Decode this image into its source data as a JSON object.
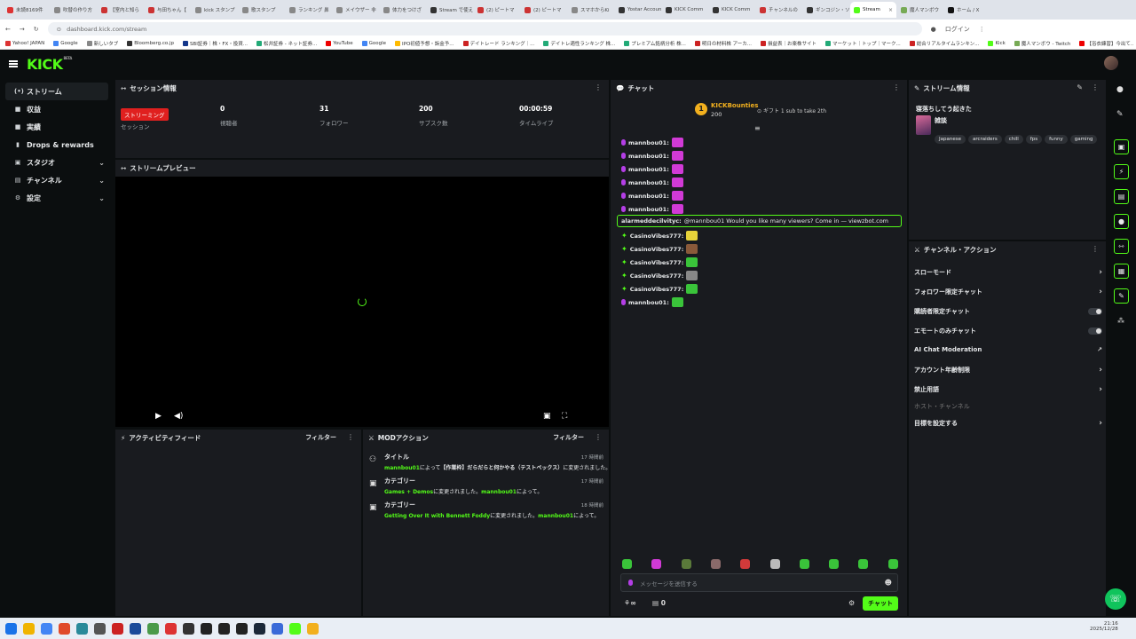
{
  "browser": {
    "tabs": [
      {
        "label": "未読8169件",
        "color": "#d33"
      },
      {
        "label": "吹替の作り方",
        "color": "#888"
      },
      {
        "label": "【室内と知ら",
        "color": "#c33"
      },
      {
        "label": "与田ちゃん【",
        "color": "#c33"
      },
      {
        "label": "kick スタンプ",
        "color": "#888"
      },
      {
        "label": "歌スタンプ",
        "color": "#888"
      },
      {
        "label": "ランキング 鼻",
        "color": "#888"
      },
      {
        "label": "メイウザー 非",
        "color": "#888"
      },
      {
        "label": "体力をつけざ",
        "color": "#888"
      },
      {
        "label": "Stream で使え",
        "color": "#333"
      },
      {
        "label": "(2) ピートマ",
        "color": "#c33"
      },
      {
        "label": "(2) ピートマ",
        "color": "#c33"
      },
      {
        "label": "スマホからKi",
        "color": "#888"
      },
      {
        "label": "Yostar Account",
        "color": "#333"
      },
      {
        "label": "KICK Comm",
        "color": "#333"
      },
      {
        "label": "KICK Comm",
        "color": "#333"
      },
      {
        "label": "チャンネルの",
        "color": "#c33"
      },
      {
        "label": "ギンコジン・ソ",
        "color": "#333"
      },
      {
        "label": "Stream",
        "color": "#53fc18",
        "active": true
      },
      {
        "label": "魔人マンボウ",
        "color": "#7a5"
      },
      {
        "label": "ホーム / X",
        "color": "#111"
      }
    ],
    "url": "dashboard.kick.com/stream",
    "login_label": "ログイン",
    "bookmarks": [
      {
        "label": "Yahoo! JAPAN",
        "color": "#d33"
      },
      {
        "label": "Google",
        "color": "#4285f4"
      },
      {
        "label": "新しいタブ",
        "color": "#888"
      },
      {
        "label": "Bloomberg.co.jp",
        "color": "#333"
      },
      {
        "label": "SBI証券｜株・FX・投資...",
        "color": "#14378b"
      },
      {
        "label": "松井証券 - ネット証券...",
        "color": "#2a7"
      },
      {
        "label": "YouTube",
        "color": "#e00"
      },
      {
        "label": "Google",
        "color": "#4285f4"
      },
      {
        "label": "IPO初値予想・訴金予...",
        "color": "#fb0"
      },
      {
        "label": "デイトレード ランキング｜...",
        "color": "#c22"
      },
      {
        "label": "デイトレ適性ランキング 株...",
        "color": "#2a7"
      },
      {
        "label": "プレミアム銘柄分析 株...",
        "color": "#2a7"
      },
      {
        "label": "明日の材料株 アーカ...",
        "color": "#c22"
      },
      {
        "label": "損益表｜お楽株サイト",
        "color": "#c22"
      },
      {
        "label": "マーケット｜トップ｜マーク...",
        "color": "#2a7"
      },
      {
        "label": "総合リアルタイムランキン...",
        "color": "#c22"
      },
      {
        "label": "Kick",
        "color": "#53fc18"
      },
      {
        "label": "魔人マンボウ - Twitch",
        "color": "#7a5"
      },
      {
        "label": "【浴衣練習】今出て..",
        "color": "#e00"
      }
    ]
  },
  "kick": {
    "logo": "KICK",
    "logo_badge": "BETA"
  },
  "sidebar": {
    "items": [
      {
        "icon": "(•)",
        "label": "ストリーム",
        "active": true,
        "chev": ""
      },
      {
        "icon": "■",
        "label": "収益",
        "chev": ""
      },
      {
        "icon": "■",
        "label": "実績",
        "chev": ""
      },
      {
        "icon": "▮",
        "label": "Drops & rewards",
        "chev": ""
      },
      {
        "icon": "▣",
        "label": "スタジオ",
        "chev": "⌄"
      },
      {
        "icon": "▤",
        "label": "チャンネル",
        "chev": "⌄"
      },
      {
        "icon": "⚙",
        "label": "設定",
        "chev": "⌄"
      }
    ]
  },
  "session": {
    "title": "セッション情報",
    "status_badge": "ストリーミング",
    "status_label": "セッション",
    "stats": [
      {
        "value": "0",
        "label": "視聴者"
      },
      {
        "value": "31",
        "label": "フォロワー"
      },
      {
        "value": "200",
        "label": "サブスク数"
      },
      {
        "value": "00:00:59",
        "label": "タイムライブ"
      }
    ]
  },
  "preview": {
    "title": "ストリームプレビュー"
  },
  "activity": {
    "title": "アクティビティフィード",
    "filter": "フィルター"
  },
  "mod": {
    "title": "MODアクション",
    "filter": "フィルター",
    "items": [
      {
        "title": "タイトル",
        "time": "17 時間前",
        "user": "mannbou01",
        "mid": "によって",
        "value": "【作業枠】だらだらと何かやる（テストペックス）",
        "end": "に変更されました。"
      },
      {
        "title": "カテゴリー",
        "time": "17 時間前",
        "value": "Games + Demos",
        "mid": "に変更されました。",
        "user": "mannbou01",
        "end": "によって。"
      },
      {
        "title": "カテゴリー",
        "time": "18 時間前",
        "value": "Getting Over It with Bennett Foddy",
        "mid": "に変更されました。",
        "user": "mannbou01",
        "end": "によって。"
      }
    ]
  },
  "chat": {
    "title": "チャット",
    "bounty_name": "KICKBounties",
    "bounty_amount": "200",
    "gift_text": "ギフト 1 sub to take 2th",
    "messages": [
      {
        "user": "mannbou01:",
        "type": "mic",
        "emote": "#d13ad6"
      },
      {
        "user": "mannbou01:",
        "type": "mic",
        "emote": "#d13ad6"
      },
      {
        "user": "mannbou01:",
        "type": "mic",
        "emote": "#d13ad6"
      },
      {
        "user": "mannbou01:",
        "type": "mic",
        "emote": "#d13ad6"
      },
      {
        "user": "mannbou01:",
        "type": "mic",
        "emote": "#d13ad6"
      },
      {
        "user": "mannbou01:",
        "type": "mic",
        "emote": "#d13ad6"
      },
      {
        "user": "CasinoVibes777:",
        "type": "spark",
        "emote": "#e6d23a"
      },
      {
        "user": "CasinoVibes777:",
        "type": "spark",
        "emote": "#8a5a3a"
      },
      {
        "user": "CasinoVibes777:",
        "type": "spark",
        "emote": "#3ac43a"
      },
      {
        "user": "CasinoVibes777:",
        "type": "spark",
        "emote": "#888888"
      },
      {
        "user": "CasinoVibes777:",
        "type": "spark",
        "emote": "#3ac43a"
      },
      {
        "user": "mannbou01:",
        "type": "mic",
        "emote": "#3ac43a"
      }
    ],
    "highlight": {
      "user": "alarmeddecilvityc:",
      "text": "@mannbou01 Would you like many viewers? Come in — viewzbot.com"
    },
    "emote_bar": [
      "#3ac43a",
      "#d13ad6",
      "#5a7a3a",
      "#8a6a6a",
      "#d23a3a",
      "#bbbbbb",
      "#3ac43a",
      "#3ac43a",
      "#3ac43a",
      "#3ac43a"
    ],
    "input_placeholder": "メッセージを送信する",
    "points": "∞",
    "count": "0",
    "send_label": "チャット"
  },
  "stream_info": {
    "title": "ストリーム情報",
    "stream_title": "寝落ちしてう起きた",
    "category": "雑談",
    "tags": [
      "Japanese",
      "arcraiders",
      "chill",
      "fps",
      "funny",
      "gaming"
    ]
  },
  "actions": {
    "title": "チャンネル・アクション",
    "items": [
      {
        "label": "スローモード",
        "kind": "arrow"
      },
      {
        "label": "フォロワー限定チャット",
        "kind": "arrow"
      },
      {
        "label": "購読者限定チャット",
        "kind": "toggle"
      },
      {
        "label": "エモートのみチャット",
        "kind": "toggle"
      },
      {
        "label": "AI Chat Moderation",
        "kind": "ext"
      },
      {
        "label": "アカウント年齢制限",
        "kind": "arrow"
      },
      {
        "label": "禁止用語",
        "kind": "arrow"
      },
      {
        "label": "ホスト・チャンネル",
        "kind": "disabled"
      },
      {
        "label": "目標を設定する",
        "kind": "arrow"
      }
    ]
  },
  "clock": {
    "time": "21:16",
    "date": "2025/12/28"
  }
}
